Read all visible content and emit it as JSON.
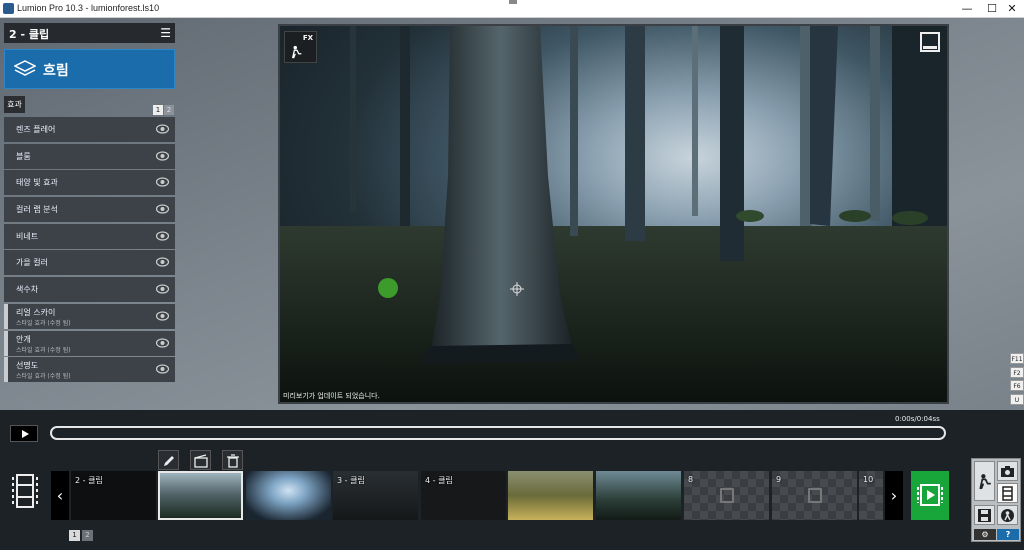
{
  "window": {
    "title": "Lumion Pro 10.3 - lumionforest.ls10",
    "minimize": "—",
    "maximize": "☐",
    "close": "✕"
  },
  "panel": {
    "title": "2 - 클립",
    "mode_label": "흐림",
    "tab_label": "효과",
    "pages": [
      "1",
      "2"
    ],
    "effects": [
      {
        "label": "렌즈 플레어",
        "sub": ""
      },
      {
        "label": "블룸",
        "sub": ""
      },
      {
        "label": "태양 빛 효과",
        "sub": ""
      },
      {
        "label": "컬러 랩 분석",
        "sub": ""
      },
      {
        "label": "비네트",
        "sub": ""
      },
      {
        "label": "가을 컬러",
        "sub": ""
      },
      {
        "label": "색수차",
        "sub": ""
      },
      {
        "label": "리얼 스카이",
        "sub": "스타일 효과 (수정 됨)"
      },
      {
        "label": "안개",
        "sub": "스타일 효과 (수정 됨)"
      },
      {
        "label": "선명도",
        "sub": "스타일 효과 (수정 됨)"
      }
    ]
  },
  "viewport": {
    "fx_badge": "FX",
    "status": "미리보기가 업데이트 되었습니다."
  },
  "side_keys": [
    "F11",
    "F2",
    "F6",
    "U"
  ],
  "timeline": {
    "timecode": "0:00s/0:04ss",
    "clips": [
      "2 - 클립",
      "",
      "",
      "3 - 클립",
      "4 - 클립",
      "",
      "",
      "8",
      "9",
      "10"
    ],
    "clip_pages": [
      "1",
      "2"
    ]
  },
  "tools": {
    "gear": "⚙",
    "help": "?"
  },
  "colors": {
    "accent_blue": "#1a6cab",
    "render_green": "#18a539"
  }
}
